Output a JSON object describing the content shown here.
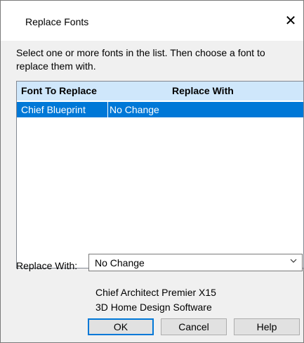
{
  "window": {
    "title": "Replace Fonts",
    "close_icon": "close-icon"
  },
  "instructions": "Select one or more fonts in the list.  Then choose a font to replace them with.",
  "list": {
    "headers": {
      "font_to_replace": "Font To Replace",
      "replace_with": "Replace With"
    },
    "rows": [
      {
        "font": "Chief Blueprint",
        "replacement": "No Change"
      }
    ]
  },
  "replace_with": {
    "label": "Replace With:",
    "selected": "No Change",
    "dropdown_icon": "chevron-down-icon"
  },
  "app_info": {
    "line1": "Chief Architect Premier X15",
    "line2": "3D Home Design Software"
  },
  "buttons": {
    "ok": "OK",
    "cancel": "Cancel",
    "help": "Help"
  },
  "colors": {
    "header_bg": "#cfe7fb",
    "selection": "#0078d7",
    "dialog_bg": "#f0f0f0"
  }
}
